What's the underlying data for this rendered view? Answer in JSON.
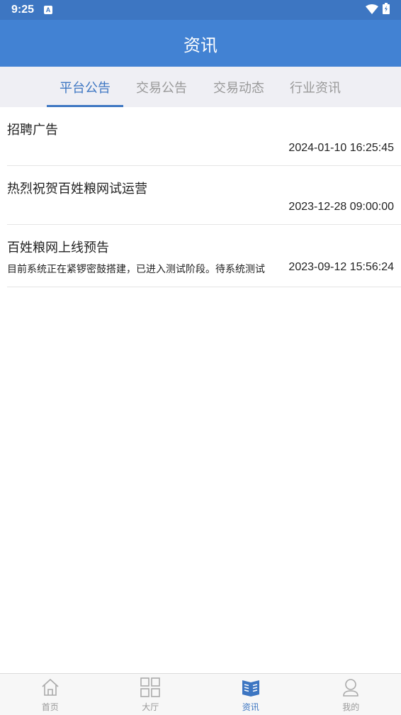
{
  "status_bar": {
    "time": "9:25",
    "notify_badge": "A"
  },
  "header": {
    "title": "资讯"
  },
  "tabs": [
    {
      "label": "平台公告",
      "active": true
    },
    {
      "label": "交易公告",
      "active": false
    },
    {
      "label": "交易动态",
      "active": false
    },
    {
      "label": "行业资讯",
      "active": false
    }
  ],
  "items": [
    {
      "title": "招聘广告",
      "time": "2024-01-10 16:25:45"
    },
    {
      "title": "热烈祝贺百姓粮网试运营",
      "time": "2023-12-28 09:00:00"
    },
    {
      "title": "百姓粮网上线预告",
      "desc": "目前系统正在紧锣密鼓搭建，已进入测试阶段。待系统测试",
      "time": "2023-09-12 15:56:24"
    }
  ],
  "bottom_nav": [
    {
      "label": "首页",
      "icon": "home-icon",
      "active": false
    },
    {
      "label": "大厅",
      "icon": "grid-icon",
      "active": false
    },
    {
      "label": "资讯",
      "icon": "news-icon",
      "active": true
    },
    {
      "label": "我的",
      "icon": "user-icon",
      "active": false
    }
  ],
  "colors": {
    "header": "#4282d3",
    "status_bar": "#3d76c2",
    "accent": "#3d76c2",
    "inactive": "#999999"
  }
}
